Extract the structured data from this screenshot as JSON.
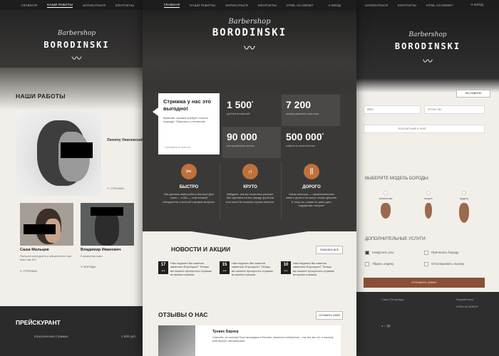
{
  "left": {
    "nav": [
      "Главная",
      "Наши работы",
      "Записаться",
      "Контакты",
      "HTML"
    ],
    "logo_script": "Barbershop",
    "logo_main": "BORODINSKI",
    "section_title": "НАШИ РАБОТЫ",
    "big_name": "Люпппу Умилевский",
    "big_sub": "",
    "big_tag": "СТРИЖКА",
    "card1": {
      "name": "Саша Мальцев",
      "text": "Получил молодость и уверенность при всех нас КС!",
      "tag": "СТРИЖКА"
    },
    "card2": {
      "name": "Владимир Иванович",
      "text": "К жизненну сказ…",
      "tag": "БОРОДА"
    },
    "price_title": "ПРЕЙСКУРАНТ",
    "price_row": "Классическая стрижка",
    "price_val": "1 500 руб."
  },
  "center": {
    "nav": [
      "Главная",
      "Наши работы",
      "Записаться",
      "Контакты",
      "HTML Academy"
    ],
    "login": "Вход",
    "logo_script": "Barbershop",
    "logo_main": "BORODINSKI",
    "promo_title": "Стрижка у нас это выгодно!",
    "promo_text": "Мужская стрижка требует точного подхода. Обратись к стилистам",
    "promo_check": "приобретите цены на",
    "stats": [
      {
        "num": "1 500",
        "lbl": "рублей вложений"
      },
      {
        "num": "7 200",
        "lbl": "секунд времени мастера"
      },
      {
        "num": "90 000",
        "lbl": "пострижённых волос"
      },
      {
        "num": "500 000",
        "lbl": "лайков в компонентах"
      }
    ],
    "features": [
      {
        "title": "БЫСТРО",
        "text": "Мы делаем свою работу быстро! Два часа — и Вы — счастливый обладатель стильной стрижки-минутки."
      },
      {
        "title": "КРУТО",
        "text": "Забудьте, как вы стриглись раньше. Мы сделаем из вас звезду футбола или кино! Во всяком случае внешне."
      },
      {
        "title": "ДОРОГО",
        "text": "Наши мастера — профессионалы своего дела и не могут стоить дёшево. К тому же, разве не цена дает ощущение статуса?"
      }
    ],
    "news_title": "НОВОСТИ И АКЦИИ",
    "news_btn": "Показать все",
    "news": [
      {
        "day": "17",
        "mon": "апр",
        "text": "Нам надоели Вы кажется заметили Enyorspee? Теперь вы можете пропустить стрижки во время стрижки."
      },
      {
        "day": "15",
        "mon": "апр",
        "text": "Нам надоели Вы кажется заметили Enyorspee? Теперь вы можете пропустить стрижки во время стрижки."
      },
      {
        "day": "10",
        "mon": "апр",
        "text": "Нам надоели Вы кажется заметили Enyorspee? Теперь вы можете пропустить стрижки во время стрижки."
      }
    ],
    "reviews_title": "ОТЗЫВЫ О НАС",
    "reviews_btn": "Оставить свой",
    "review_name": "Трэвис Баркер",
    "review_text": "Спасибо за лысину! Был проездом в Москве, заскочил побриться - так вот вы тут и лысину мне вкусно затериорили."
  },
  "right": {
    "nav": [
      "Записаться",
      "Контакты",
      "HTML Academy"
    ],
    "login": "Вход",
    "logo_script": "Barbershop",
    "logo_main": "BORODINSKI",
    "back_btn": "На главную",
    "field_name": "Имя",
    "field_patronymic": "Отчество",
    "field_email": "Контактный e-mail",
    "section_beard": "ВЫБЕРИТЕ МОДЕЛЬ БОРОДЫ:",
    "beards": [
      "эспаньолка",
      "вокрин",
      "мудрец"
    ],
    "section_extra": "ДОПОЛНИТЕЛЬНЫЕ УСЛУГИ:",
    "extras": [
      "Накрутить усы",
      "Убрать седину",
      "Причесать бороду",
      "Отполировать лысину"
    ],
    "submit": "Отправить заявку",
    "footer_a": "Санкт-Петербург,",
    "footer_b": "Разработано:",
    "footer_c": "HTML ACADEMY"
  }
}
